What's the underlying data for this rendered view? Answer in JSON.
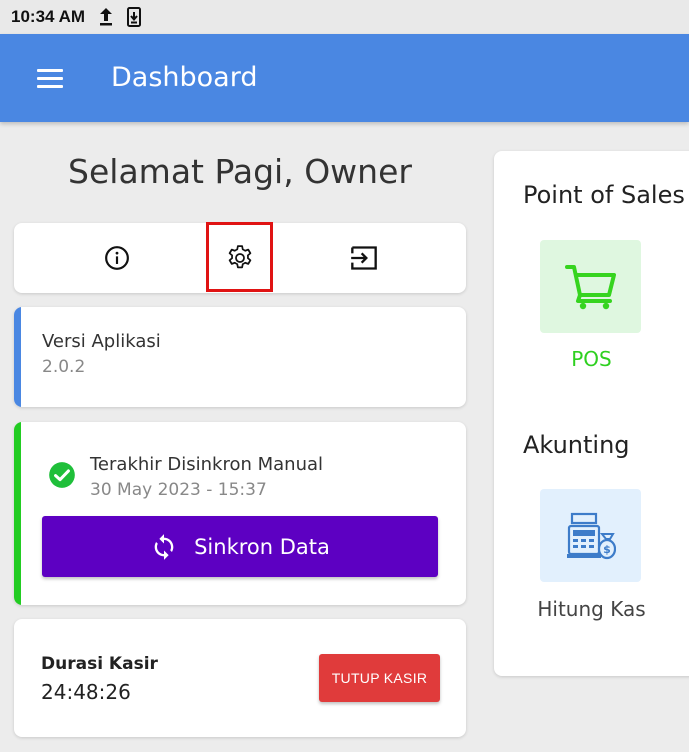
{
  "status_bar": {
    "time": "10:34 AM",
    "icons": [
      "upload-icon",
      "download-icon"
    ]
  },
  "app_bar": {
    "title": "Dashboard",
    "menu_icon": "hamburger-menu-icon",
    "color": "#4a87e2"
  },
  "greeting": "Selamat Pagi, Owner",
  "actions": [
    {
      "icon": "info-icon"
    },
    {
      "icon": "settings-gear-icon",
      "highlighted": true
    },
    {
      "icon": "logout-icon"
    }
  ],
  "version": {
    "label": "Versi Aplikasi",
    "value": "2.0.2",
    "accent_color": "#4a87e2"
  },
  "sync": {
    "status_label": "Terakhir Disinkron Manual",
    "timestamp": "30 May 2023 - 15:37",
    "button_label": "Sinkron Data",
    "accent_color": "#22cc22",
    "button_color": "#5d00c2"
  },
  "cashier": {
    "label": "Durasi Kasir",
    "duration": "24:48:26",
    "close_button_label": "TUTUP KASIR",
    "button_color": "#e03b3b"
  },
  "right_panel": {
    "pos_section_title": "Point of Sales",
    "pos_tile_label": "POS",
    "pos_icon": "shopping-cart-icon",
    "accounting_section_title": "Akunting",
    "kas_tile_label": "Hitung Kas",
    "kas_icon": "cash-register-icon"
  }
}
